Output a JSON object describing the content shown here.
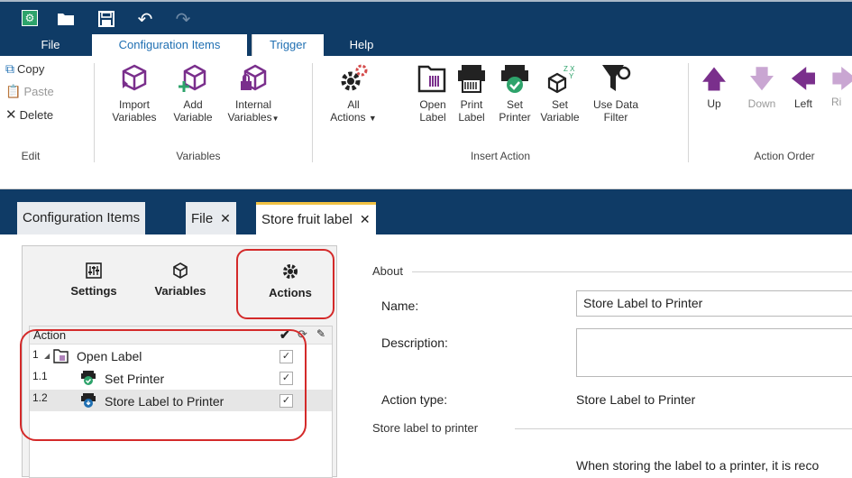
{
  "titlebar": {
    "icons": [
      "app-icon",
      "open-folder-icon",
      "save-icon",
      "undo-icon",
      "redo-icon"
    ]
  },
  "menu": {
    "items": [
      "File",
      "Configuration Items",
      "Trigger",
      "Help"
    ],
    "active": "Configuration Items"
  },
  "ribbon": {
    "edit": {
      "copy": "Copy",
      "paste": "Paste",
      "delete": "Delete",
      "group": "Edit"
    },
    "variables": {
      "import_l1": "Import",
      "import_l2": "Variables",
      "add_l1": "Add",
      "add_l2": "Variable",
      "internal_l1": "Internal",
      "internal_l2": "Variables",
      "group": "Variables"
    },
    "insert_action": {
      "all_l1": "All",
      "all_l2": "Actions",
      "open_l1": "Open",
      "open_l2": "Label",
      "print_l1": "Print",
      "print_l2": "Label",
      "setprinter_l1": "Set",
      "setprinter_l2": "Printer",
      "setvar_l1": "Set",
      "setvar_l2": "Variable",
      "usedata_l1": "Use Data",
      "usedata_l2": "Filter",
      "group": "Insert Action"
    },
    "action_order": {
      "up": "Up",
      "down": "Down",
      "left": "Left",
      "right": "Ri",
      "group": "Action Order"
    }
  },
  "doc_tabs": [
    {
      "label": "Configuration Items",
      "closable": false
    },
    {
      "label": "File",
      "closable": true
    },
    {
      "label": "Store fruit label",
      "closable": true,
      "active": true
    }
  ],
  "left_panel": {
    "nav": {
      "settings": "Settings",
      "variables": "Variables",
      "actions": "Actions"
    },
    "grid": {
      "header": "Action",
      "rows": [
        {
          "num": "1",
          "label": "Open Label",
          "checked": true
        },
        {
          "num": "1.1",
          "label": "Set Printer",
          "checked": true
        },
        {
          "num": "1.2",
          "label": "Store Label to Printer",
          "checked": true,
          "selected": true
        }
      ]
    }
  },
  "right_panel": {
    "about_title": "About",
    "name_label": "Name:",
    "name_value": "Store Label to Printer",
    "description_label": "Description:",
    "description_value": "",
    "action_type_label": "Action type:",
    "action_type_value": "Store Label to Printer",
    "section2_title": "Store label to printer",
    "info_text": "When storing the label to a printer, it is reco"
  },
  "colors": {
    "titlebar_bg": "#0f3b66",
    "accent_blue": "#1f6fb2",
    "purple_icon": "#7a2f8c",
    "green_check": "#2ea36b",
    "highlight_red": "#d42a2a",
    "tab_yellow": "#f1c244"
  }
}
